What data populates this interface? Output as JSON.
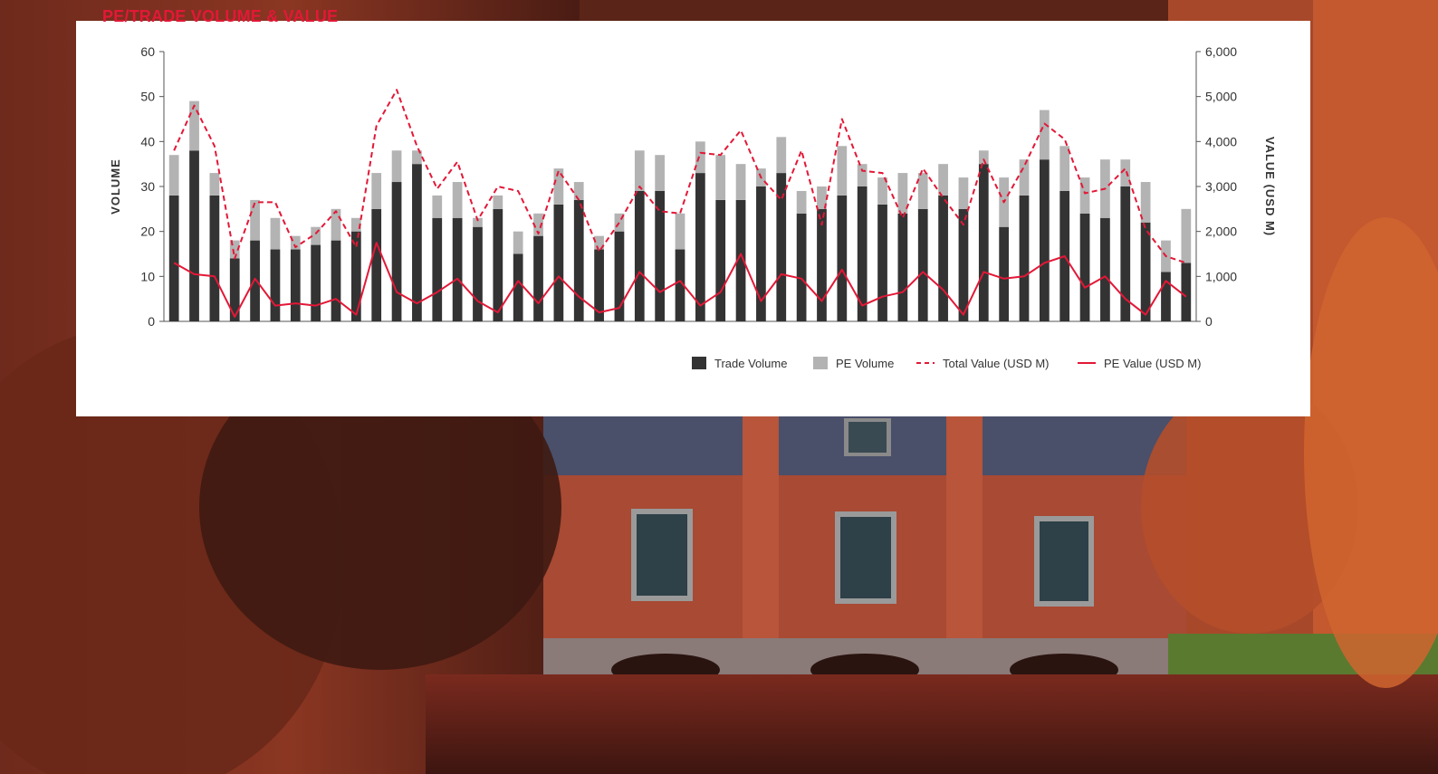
{
  "chart_data": {
    "type": "bar",
    "title": "PE/TRADE VOLUME & VALUE",
    "ylabel": "VOLUME",
    "y2label": "VALUE (USD M)",
    "ylim": [
      0,
      60
    ],
    "y2lim": [
      0,
      6000
    ],
    "yticks": [
      "0",
      "10",
      "20",
      "30",
      "40",
      "50",
      "60"
    ],
    "y2ticks": [
      "0",
      "1,000",
      "2,000",
      "3,000",
      "4,000",
      "5,000",
      "6,000"
    ],
    "stacked": true,
    "grid": false,
    "legend_position": "bottom-right",
    "series": [
      {
        "name": "Trade Volume",
        "kind": "bar",
        "axis": "left",
        "color": "#333333",
        "values": [
          28,
          38,
          28,
          14,
          18,
          16,
          16,
          17,
          18,
          20,
          25,
          31,
          35,
          23,
          23,
          21,
          25,
          15,
          19,
          26,
          27,
          16,
          20,
          29,
          29,
          16,
          33,
          27,
          27,
          30,
          33,
          24,
          25,
          28,
          30,
          26,
          24,
          25,
          28,
          25,
          35,
          21,
          28,
          36,
          29,
          24,
          23,
          30,
          22,
          11,
          13
        ]
      },
      {
        "name": "PE Volume",
        "kind": "bar",
        "axis": "left",
        "color": "#b3b3b3",
        "values": [
          9,
          11,
          5,
          4,
          9,
          7,
          3,
          4,
          7,
          3,
          8,
          7,
          3,
          5,
          8,
          2,
          3,
          5,
          5,
          8,
          4,
          3,
          4,
          9,
          8,
          8,
          7,
          10,
          8,
          4,
          8,
          5,
          5,
          11,
          5,
          6,
          9,
          8,
          7,
          7,
          3,
          11,
          8,
          11,
          10,
          8,
          13,
          6,
          9,
          7,
          12
        ]
      },
      {
        "name": "Total Value (USD M)",
        "kind": "line",
        "axis": "right",
        "dash": true,
        "color": "#e31837",
        "values": [
          3800,
          4800,
          3900,
          1400,
          2650,
          2650,
          1650,
          1950,
          2450,
          1650,
          4350,
          5150,
          3900,
          2950,
          3550,
          2250,
          3000,
          2900,
          1950,
          3350,
          2700,
          1550,
          2200,
          3000,
          2450,
          2400,
          3750,
          3700,
          4250,
          3200,
          2700,
          3800,
          2150,
          4500,
          3350,
          3300,
          2300,
          3400,
          2750,
          2150,
          3600,
          2650,
          3450,
          4400,
          4050,
          2850,
          2950,
          3400,
          2050,
          1450,
          1300
        ]
      },
      {
        "name": "PE Value (USD M)",
        "kind": "line",
        "axis": "right",
        "dash": false,
        "color": "#e31837",
        "values": [
          1300,
          1050,
          1000,
          100,
          950,
          350,
          400,
          350,
          500,
          150,
          1750,
          650,
          400,
          650,
          950,
          450,
          200,
          900,
          400,
          1000,
          550,
          200,
          300,
          1100,
          650,
          900,
          350,
          650,
          1500,
          450,
          1050,
          950,
          450,
          1150,
          350,
          550,
          650,
          1100,
          700,
          150,
          1100,
          950,
          1000,
          1300,
          1450,
          750,
          1000,
          500,
          150,
          900,
          550
        ]
      }
    ]
  },
  "colors": {
    "accent": "#e31837",
    "trade_volume": "#333333",
    "pe_volume": "#b3b3b3"
  }
}
